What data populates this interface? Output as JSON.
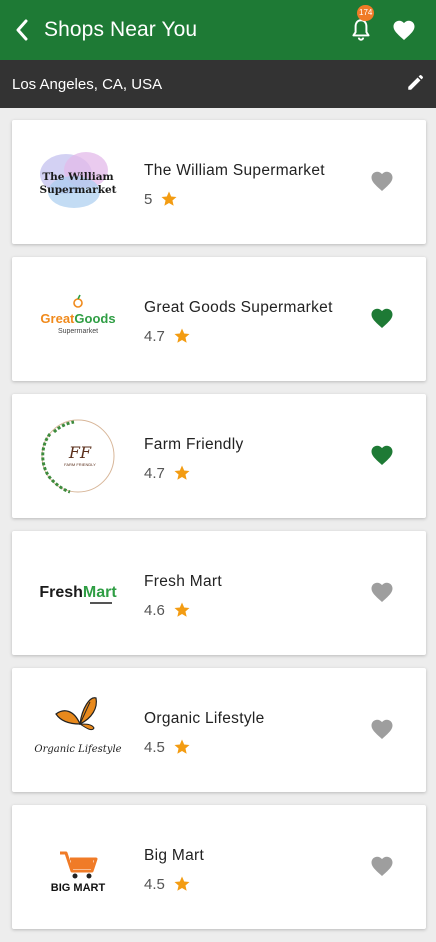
{
  "header": {
    "title": "Shops Near You",
    "notification_count": "174"
  },
  "location": {
    "text": "Los Angeles, CA, USA"
  },
  "colors": {
    "primary": "#1e7a35",
    "star": "#f39c12",
    "fav_active": "#1e7a35",
    "fav_inactive": "#9e9e9e"
  },
  "shops": [
    {
      "name": "The William Supermarket",
      "rating": "5",
      "favorite": false,
      "logo": "the-william-supermarket-logo",
      "logo_text": "The William Supermarket"
    },
    {
      "name": "Great Goods Supermarket",
      "rating": "4.7",
      "favorite": true,
      "logo": "great-goods-logo",
      "logo_text": "GreatGoods",
      "logo_sub": "Supermarket"
    },
    {
      "name": "Farm Friendly",
      "rating": "4.7",
      "favorite": true,
      "logo": "farm-friendly-logo",
      "logo_text": "FF"
    },
    {
      "name": "Fresh Mart",
      "rating": "4.6",
      "favorite": false,
      "logo": "fresh-mart-logo",
      "logo_text": "FreshMart"
    },
    {
      "name": "Organic Lifestyle",
      "rating": "4.5",
      "favorite": false,
      "logo": "organic-lifestyle-logo",
      "logo_text": "Organic Lifestyle"
    },
    {
      "name": "Big Mart",
      "rating": "4.5",
      "favorite": false,
      "logo": "big-mart-logo",
      "logo_text": "BIG MART"
    }
  ]
}
